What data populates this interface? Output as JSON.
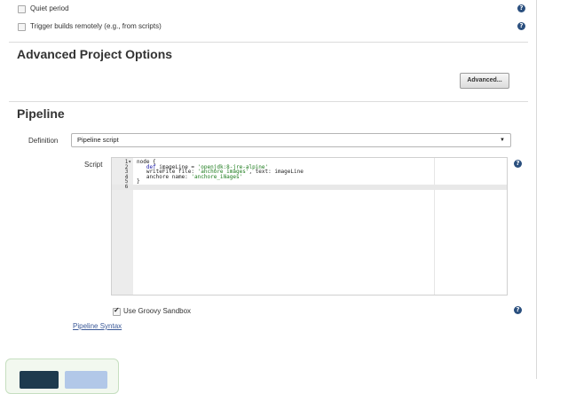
{
  "triggers": {
    "quiet_period_label": "Quiet period",
    "remote_trigger_label": "Trigger builds remotely (e.g., from scripts)"
  },
  "advanced_options": {
    "title": "Advanced Project Options",
    "advanced_button": "Advanced..."
  },
  "pipeline": {
    "title": "Pipeline",
    "definition_label": "Definition",
    "definition_value": "Pipeline script",
    "script_label": "Script",
    "code_lines": [
      {
        "num": "1",
        "fold": "▾",
        "parts": [
          {
            "t": "node {",
            "c": ""
          }
        ]
      },
      {
        "num": "2",
        "fold": "",
        "parts": [
          {
            "t": "   ",
            "c": ""
          },
          {
            "t": "def",
            "c": "kw"
          },
          {
            "t": " imageLine = ",
            "c": ""
          },
          {
            "t": "'openjdk:8-jre-alpine'",
            "c": "str"
          }
        ]
      },
      {
        "num": "3",
        "fold": "",
        "parts": [
          {
            "t": "   writeFile file: ",
            "c": ""
          },
          {
            "t": "'anchore_images'",
            "c": "str"
          },
          {
            "t": ", text: imageLine",
            "c": ""
          }
        ]
      },
      {
        "num": "4",
        "fold": "",
        "parts": [
          {
            "t": "   anchore name: ",
            "c": ""
          },
          {
            "t": "'anchore_images'",
            "c": "str"
          }
        ]
      },
      {
        "num": "5",
        "fold": "",
        "parts": [
          {
            "t": "}",
            "c": ""
          }
        ]
      },
      {
        "num": "6",
        "fold": "",
        "parts": []
      }
    ],
    "sandbox_label": "Use Groovy Sandbox",
    "syntax_link": "Pipeline Syntax"
  },
  "help_glyph": "?",
  "icons": [
    "checkbox",
    "help-icon",
    "dropdown-arrow-icon"
  ]
}
